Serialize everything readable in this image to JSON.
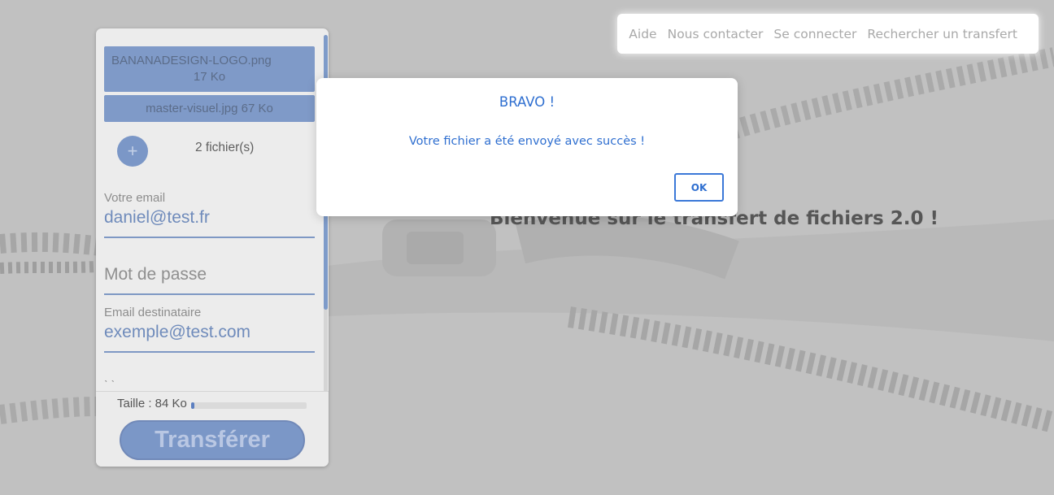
{
  "nav": {
    "items": [
      "Aide",
      "Nous contacter",
      "Se connecter",
      "Rechercher un transfert"
    ]
  },
  "welcome_text": "Bienvenue sur le transfert de fichiers 2.0 !",
  "upload": {
    "files": [
      {
        "name": "BANANADESIGN-LOGO.png",
        "size": "17 Ko"
      },
      {
        "label": "master-visuel.jpg 67 Ko"
      }
    ],
    "add_icon": "plus-icon",
    "add_glyph": "+",
    "file_count": "2 fichier(s)",
    "email_label": "Votre email",
    "email_value": "daniel@test.fr",
    "password_placeholder": "Mot de passe",
    "recipient_label": "Email destinataire",
    "recipient_value": "exemple@test.com",
    "message_partial": "ˋ ˋ",
    "size_label": "Taille : 84 Ko",
    "progress_fraction": 0.03,
    "transfer_label": "Transférer"
  },
  "dialog": {
    "title": "BRAVO !",
    "message": "Votre fichier a été envoyé avec succès !",
    "ok_label": "OK"
  },
  "colors": {
    "accent_blue": "#2f6fd0",
    "panel_blue": "#7f9ac8",
    "overlay": "#6e6e6e"
  }
}
